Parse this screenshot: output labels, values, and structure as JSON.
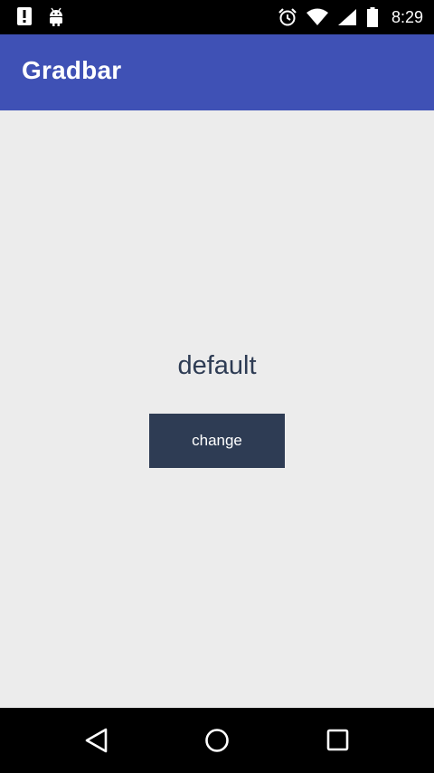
{
  "status_bar": {
    "time": "8:29",
    "left_icons": [
      "alert-icon",
      "android-icon"
    ],
    "right_icons": [
      "alarm-icon",
      "wifi-icon",
      "signal-icon",
      "battery-icon"
    ]
  },
  "app_bar": {
    "title": "Gradbar",
    "color": "#3f51b5"
  },
  "main": {
    "status_text": "default",
    "button_label": "change",
    "text_color": "#2e3c54",
    "button_color": "#2e3c54",
    "background_color": "#ececec"
  },
  "nav_bar": {
    "buttons": [
      "back-icon",
      "home-icon",
      "recents-icon"
    ]
  }
}
